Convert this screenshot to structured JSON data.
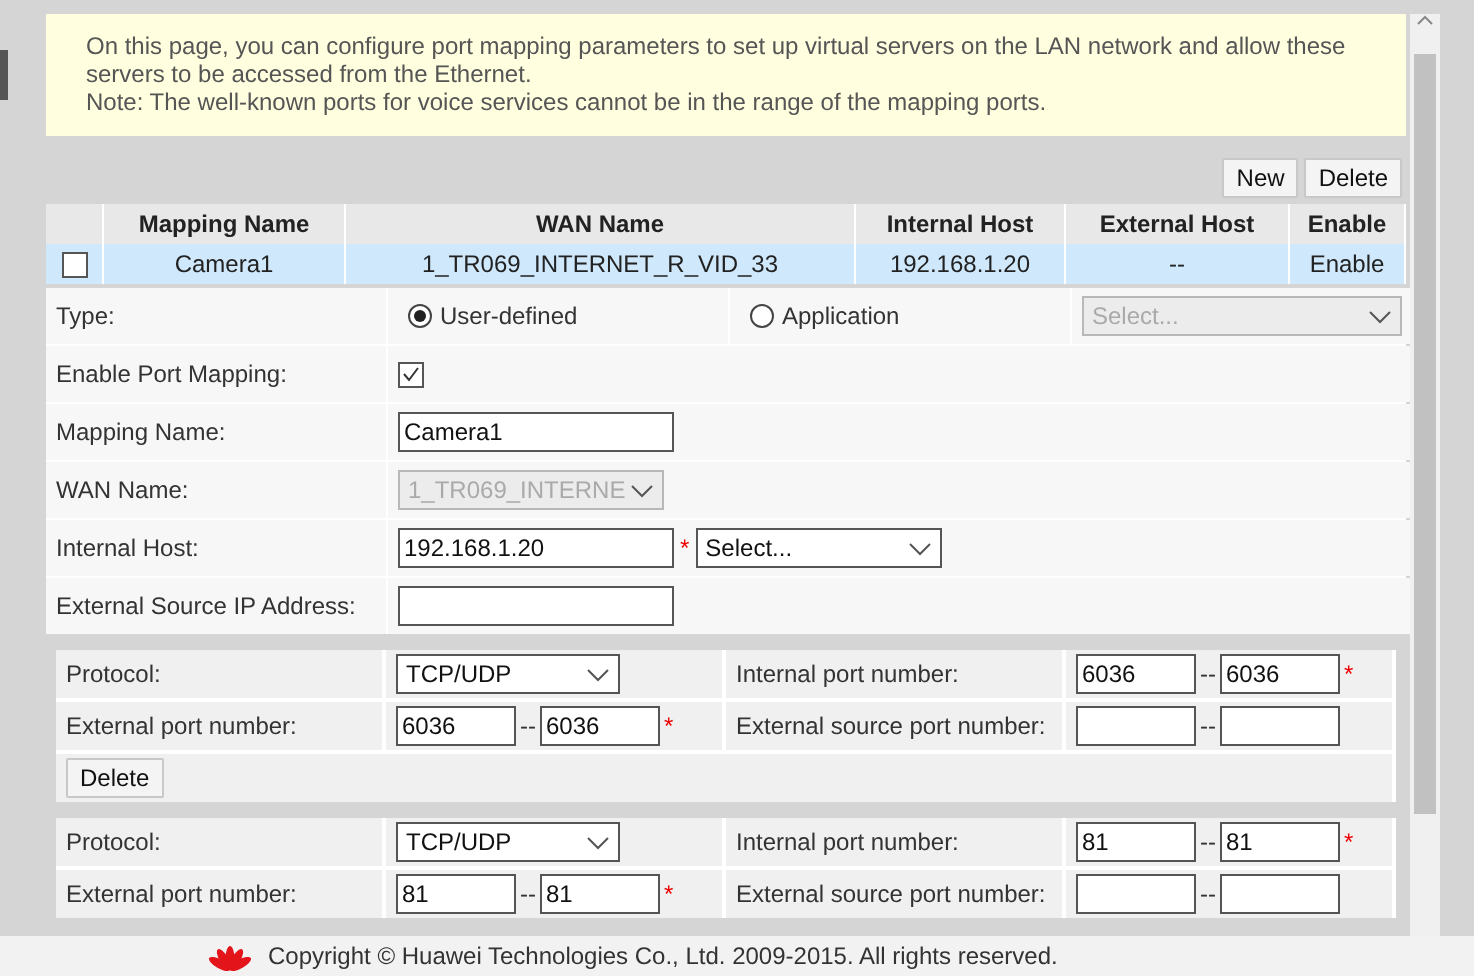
{
  "notice": {
    "lines": [
      "On this page, you can configure port mapping parameters to set up virtual servers on the LAN network and allow these servers to be accessed from the Ethernet.",
      "Note: The well-known ports for voice services cannot be in the range of the mapping ports."
    ]
  },
  "toolbar": {
    "buttons": [
      "New",
      "Delete"
    ]
  },
  "table": {
    "columns": [
      "Mapping Name",
      "WAN Name",
      "Internal Host",
      "External Host",
      "Enable"
    ],
    "rows": [
      {
        "checked": false,
        "selected": true,
        "cells": [
          "Camera1",
          "1_TR069_INTERNET_R_VID_33",
          "192.168.1.20",
          "--",
          "Enable"
        ]
      }
    ]
  },
  "form": {
    "type": {
      "label": "Type:",
      "options": [
        {
          "label": "User-defined",
          "selected": true
        },
        {
          "label": "Application",
          "selected": false
        }
      ],
      "select": {
        "placeholder": "Select...",
        "disabled": true
      }
    },
    "enable": {
      "label": "Enable Port Mapping:",
      "checked": true
    },
    "mapping_name": {
      "label": "Mapping Name:",
      "value": "Camera1"
    },
    "wan_name": {
      "label": "WAN Name:",
      "value": "1_TR069_INTERNE",
      "disabled": true
    },
    "internal_host": {
      "label": "Internal Host:",
      "value": "192.168.1.20",
      "required_mark": "*",
      "select": {
        "placeholder": "Select...",
        "disabled": false
      }
    },
    "external_source_ip": {
      "label": "External Source IP Address:"
    }
  },
  "port_groups": [
    {
      "protocol": {
        "label": "Protocol:",
        "value": "TCP/UDP"
      },
      "internal_port": {
        "label": "Internal port number:",
        "from": "6036",
        "separator": "--",
        "to": "6036",
        "required_mark": "*"
      },
      "external_port": {
        "label": "External port number:",
        "from": "6036",
        "separator": "--",
        "to": "6036",
        "required_mark": "*"
      },
      "external_source_port": {
        "label": "External source port number:",
        "separator": "--"
      },
      "delete_button": "Delete"
    },
    {
      "protocol": {
        "label": "Protocol:",
        "value": "TCP/UDP"
      },
      "internal_port": {
        "label": "Internal port number:",
        "from": "81",
        "separator": "--",
        "to": "81",
        "required_mark": "*"
      },
      "external_port": {
        "label": "External port number:",
        "from": "81",
        "separator": "--",
        "to": "81",
        "required_mark": "*"
      },
      "external_source_port": {
        "label": "External source port number:",
        "separator": "--"
      }
    }
  ],
  "footer": {
    "copyright": "Copyright © Huawei Technologies Co., Ltd. 2009-2015. All rights reserved."
  }
}
